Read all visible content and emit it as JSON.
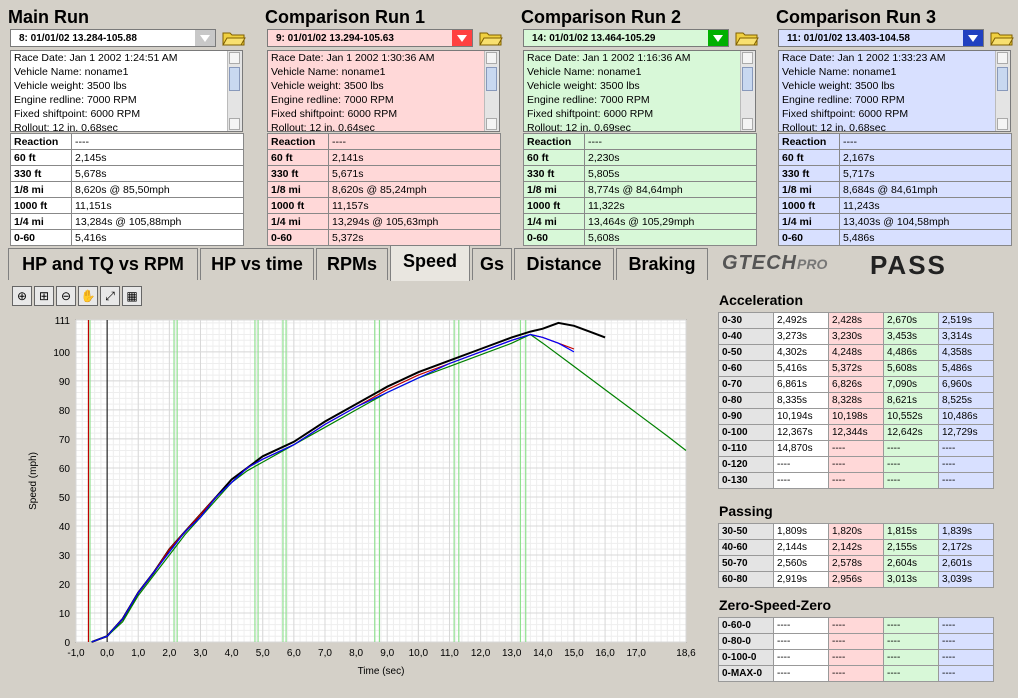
{
  "runs": [
    {
      "title": "Main Run",
      "selection": "8:   01/01/02 13.284-105.88",
      "info": [
        "Race Date: Jan 1 2002  1:24:51 AM",
        "Vehicle Name: noname1",
        "Vehicle weight: 3500 lbs",
        "Engine redline: 7000 RPM",
        "Fixed shiftpoint: 6000 RPM",
        "Rollout: 12 in, 0,68sec"
      ],
      "results": [
        [
          "Reaction",
          "----"
        ],
        [
          "60 ft",
          "2,145s"
        ],
        [
          "330 ft",
          "5,678s"
        ],
        [
          "1/8 mi",
          "8,620s @ 85,50mph"
        ],
        [
          "1000 ft",
          "11,151s"
        ],
        [
          "1/4 mi",
          "13,284s @ 105,88mph"
        ],
        [
          "0-60",
          "5,416s"
        ]
      ]
    },
    {
      "title": "Comparison Run 1",
      "selection": "9:   01/01/02 13.294-105.63",
      "info": [
        "Race Date: Jan 1 2002  1:30:36 AM",
        "Vehicle Name: noname1",
        "Vehicle weight: 3500 lbs",
        "Engine redline: 7000 RPM",
        "Fixed shiftpoint: 6000 RPM",
        "Rollout: 12 in, 0,64sec"
      ],
      "results": [
        [
          "Reaction",
          "----"
        ],
        [
          "60 ft",
          "2,141s"
        ],
        [
          "330 ft",
          "5,671s"
        ],
        [
          "1/8 mi",
          "8,620s @ 85,24mph"
        ],
        [
          "1000 ft",
          "11,157s"
        ],
        [
          "1/4 mi",
          "13,294s @ 105,63mph"
        ],
        [
          "0-60",
          "5,372s"
        ]
      ]
    },
    {
      "title": "Comparison Run 2",
      "selection": "14:   01/01/02 13.464-105.29",
      "info": [
        "Race Date: Jan 1 2002  1:16:36 AM",
        "Vehicle Name: noname1",
        "Vehicle weight: 3500 lbs",
        "Engine redline: 7000 RPM",
        "Fixed shiftpoint: 6000 RPM",
        "Rollout: 12 in, 0,69sec"
      ],
      "results": [
        [
          "Reaction",
          "----"
        ],
        [
          "60 ft",
          "2,230s"
        ],
        [
          "330 ft",
          "5,805s"
        ],
        [
          "1/8 mi",
          "8,774s @ 84,64mph"
        ],
        [
          "1000 ft",
          "11,322s"
        ],
        [
          "1/4 mi",
          "13,464s @ 105,29mph"
        ],
        [
          "0-60",
          "5,608s"
        ]
      ]
    },
    {
      "title": "Comparison Run 3",
      "selection": "11:   01/01/02 13.403-104.58",
      "info": [
        "Race Date: Jan 1 2002  1:33:23 AM",
        "Vehicle Name: noname1",
        "Vehicle weight: 3500 lbs",
        "Engine redline: 7000 RPM",
        "Fixed shiftpoint: 6000 RPM",
        "Rollout: 12 in, 0,68sec"
      ],
      "results": [
        [
          "Reaction",
          "----"
        ],
        [
          "60 ft",
          "2,167s"
        ],
        [
          "330 ft",
          "5,717s"
        ],
        [
          "1/8 mi",
          "8,684s @ 84,61mph"
        ],
        [
          "1000 ft",
          "11,243s"
        ],
        [
          "1/4 mi",
          "13,403s @ 104,58mph"
        ],
        [
          "0-60",
          "5,486s"
        ]
      ]
    }
  ],
  "run_colors": {
    "header": [
      "#ffffff",
      "#ff4040",
      "#00b000",
      "#2040c0"
    ],
    "panel": [
      "#ffffff",
      "#ffd8d8",
      "#d8f8d8",
      "#d8e0ff"
    ],
    "line": [
      "#000000",
      "#c00000",
      "#008000",
      "#0000ff"
    ]
  },
  "tabs": [
    "HP and TQ vs RPM",
    "HP vs time",
    "RPMs",
    "Speed",
    "Gs",
    "Distance",
    "Braking"
  ],
  "active_tab": "Speed",
  "brand": {
    "logo": "GTECH",
    "logo_suffix": "PRO",
    "product": "PASS"
  },
  "toolbar": [
    "zoom-in-icon",
    "zoom-box-icon",
    "zoom-out-icon",
    "pan-hand-icon",
    "fit-icon",
    "grid-icon"
  ],
  "acceleration": {
    "title": "Acceleration",
    "rows": [
      [
        "0-30",
        "2,492s",
        "2,428s",
        "2,670s",
        "2,519s"
      ],
      [
        "0-40",
        "3,273s",
        "3,230s",
        "3,453s",
        "3,314s"
      ],
      [
        "0-50",
        "4,302s",
        "4,248s",
        "4,486s",
        "4,358s"
      ],
      [
        "0-60",
        "5,416s",
        "5,372s",
        "5,608s",
        "5,486s"
      ],
      [
        "0-70",
        "6,861s",
        "6,826s",
        "7,090s",
        "6,960s"
      ],
      [
        "0-80",
        "8,335s",
        "8,328s",
        "8,621s",
        "8,525s"
      ],
      [
        "0-90",
        "10,194s",
        "10,198s",
        "10,552s",
        "10,486s"
      ],
      [
        "0-100",
        "12,367s",
        "12,344s",
        "12,642s",
        "12,729s"
      ],
      [
        "0-110",
        "14,870s",
        "----",
        "----",
        "----"
      ],
      [
        "0-120",
        "----",
        "----",
        "----",
        "----"
      ],
      [
        "0-130",
        "----",
        "----",
        "----",
        "----"
      ]
    ]
  },
  "passing": {
    "title": "Passing",
    "rows": [
      [
        "30-50",
        "1,809s",
        "1,820s",
        "1,815s",
        "1,839s"
      ],
      [
        "40-60",
        "2,144s",
        "2,142s",
        "2,155s",
        "2,172s"
      ],
      [
        "50-70",
        "2,560s",
        "2,578s",
        "2,604s",
        "2,601s"
      ],
      [
        "60-80",
        "2,919s",
        "2,956s",
        "3,013s",
        "3,039s"
      ]
    ]
  },
  "zero_speed_zero": {
    "title": "Zero-Speed-Zero",
    "rows": [
      [
        "0-60-0",
        "----",
        "----",
        "----",
        "----"
      ],
      [
        "0-80-0",
        "----",
        "----",
        "----",
        "----"
      ],
      [
        "0-100-0",
        "----",
        "----",
        "----",
        "----"
      ],
      [
        "0-MAX-0",
        "----",
        "----",
        "----",
        "----"
      ]
    ]
  },
  "chart_data": {
    "type": "line",
    "xlabel": "Time (sec)",
    "ylabel": "Speed (mph)",
    "xlim": [
      -1.0,
      18.6
    ],
    "ylim": [
      0,
      111
    ],
    "x_ticks": [
      "-1,0",
      "0,0",
      "1,0",
      "2,0",
      "3,0",
      "4,0",
      "5,0",
      "6,0",
      "7,0",
      "8,0",
      "9,0",
      "10,0",
      "11,0",
      "12,0",
      "13,0",
      "14,0",
      "15,0",
      "16,0",
      "17,0",
      "18,6"
    ],
    "y_ticks": [
      "0",
      "10",
      "20",
      "30",
      "40",
      "50",
      "60",
      "70",
      "80",
      "90",
      "100",
      "111"
    ],
    "grid": true,
    "series": [
      {
        "color": "#000000",
        "points": [
          [
            -0.5,
            0
          ],
          [
            0,
            2
          ],
          [
            0.5,
            8
          ],
          [
            1,
            17
          ],
          [
            1.5,
            24
          ],
          [
            2,
            32
          ],
          [
            2.5,
            38
          ],
          [
            3,
            44
          ],
          [
            3.5,
            50
          ],
          [
            4,
            56
          ],
          [
            4.5,
            60
          ],
          [
            5,
            64
          ],
          [
            6,
            69
          ],
          [
            7,
            76
          ],
          [
            8,
            82
          ],
          [
            9,
            88
          ],
          [
            10,
            93
          ],
          [
            11,
            97
          ],
          [
            12,
            101
          ],
          [
            13,
            105
          ],
          [
            13.6,
            107
          ],
          [
            14,
            108
          ],
          [
            14.5,
            110
          ],
          [
            15,
            109
          ],
          [
            15.5,
            107
          ],
          [
            16,
            105
          ]
        ]
      },
      {
        "color": "#c00000",
        "points": [
          [
            -0.5,
            0
          ],
          [
            0,
            2
          ],
          [
            0.5,
            8
          ],
          [
            1,
            17
          ],
          [
            1.5,
            24
          ],
          [
            2,
            32
          ],
          [
            2.5,
            38
          ],
          [
            3,
            44
          ],
          [
            3.5,
            50
          ],
          [
            4,
            55
          ],
          [
            4.5,
            60
          ],
          [
            5,
            63
          ],
          [
            6,
            68
          ],
          [
            7,
            75
          ],
          [
            8,
            81
          ],
          [
            9,
            87
          ],
          [
            10,
            92
          ],
          [
            11,
            96
          ],
          [
            12,
            100
          ],
          [
            13,
            104
          ],
          [
            13.6,
            106
          ],
          [
            14,
            105
          ],
          [
            14.5,
            103
          ],
          [
            15,
            101
          ]
        ]
      },
      {
        "color": "#008000",
        "points": [
          [
            -0.5,
            0
          ],
          [
            0,
            2
          ],
          [
            0.5,
            7
          ],
          [
            1,
            16
          ],
          [
            1.5,
            23
          ],
          [
            2,
            30
          ],
          [
            2.5,
            37
          ],
          [
            3,
            43
          ],
          [
            3.5,
            49
          ],
          [
            4,
            55
          ],
          [
            4.5,
            59
          ],
          [
            5,
            62
          ],
          [
            6,
            68
          ],
          [
            7,
            74
          ],
          [
            8,
            80
          ],
          [
            9,
            86
          ],
          [
            10,
            91
          ],
          [
            11,
            95
          ],
          [
            12,
            99
          ],
          [
            13,
            103
          ],
          [
            13.6,
            106
          ],
          [
            14,
            103
          ],
          [
            15,
            95
          ],
          [
            16,
            87
          ],
          [
            17,
            79
          ],
          [
            18,
            71
          ],
          [
            18.6,
            66
          ]
        ]
      },
      {
        "color": "#0000ff",
        "points": [
          [
            -0.5,
            0
          ],
          [
            0,
            2
          ],
          [
            0.5,
            8
          ],
          [
            1,
            17
          ],
          [
            1.5,
            24
          ],
          [
            2,
            31
          ],
          [
            2.5,
            38
          ],
          [
            3,
            43
          ],
          [
            3.5,
            50
          ],
          [
            4,
            55
          ],
          [
            4.5,
            60
          ],
          [
            5,
            63
          ],
          [
            6,
            68
          ],
          [
            7,
            75
          ],
          [
            8,
            81
          ],
          [
            9,
            86
          ],
          [
            10,
            91
          ],
          [
            11,
            96
          ],
          [
            12,
            100
          ],
          [
            13,
            104
          ],
          [
            13.6,
            106
          ],
          [
            14,
            105
          ],
          [
            14.5,
            103
          ],
          [
            15,
            100
          ]
        ]
      }
    ],
    "markers": [
      {
        "x": -0.6,
        "color": "#c00000"
      },
      {
        "x": -0.55,
        "color": "#90e090"
      },
      {
        "x": 2.15,
        "color": "#90e090"
      },
      {
        "x": 2.25,
        "color": "#90e090"
      },
      {
        "x": 4.75,
        "color": "#90e090"
      },
      {
        "x": 4.85,
        "color": "#90e090"
      },
      {
        "x": 5.65,
        "color": "#90e090"
      },
      {
        "x": 5.75,
        "color": "#90e090"
      },
      {
        "x": 8.6,
        "color": "#90e090"
      },
      {
        "x": 8.75,
        "color": "#90e090"
      },
      {
        "x": 11.15,
        "color": "#90e090"
      },
      {
        "x": 11.3,
        "color": "#90e090"
      },
      {
        "x": 13.28,
        "color": "#90e090"
      },
      {
        "x": 13.45,
        "color": "#90e090"
      }
    ]
  }
}
